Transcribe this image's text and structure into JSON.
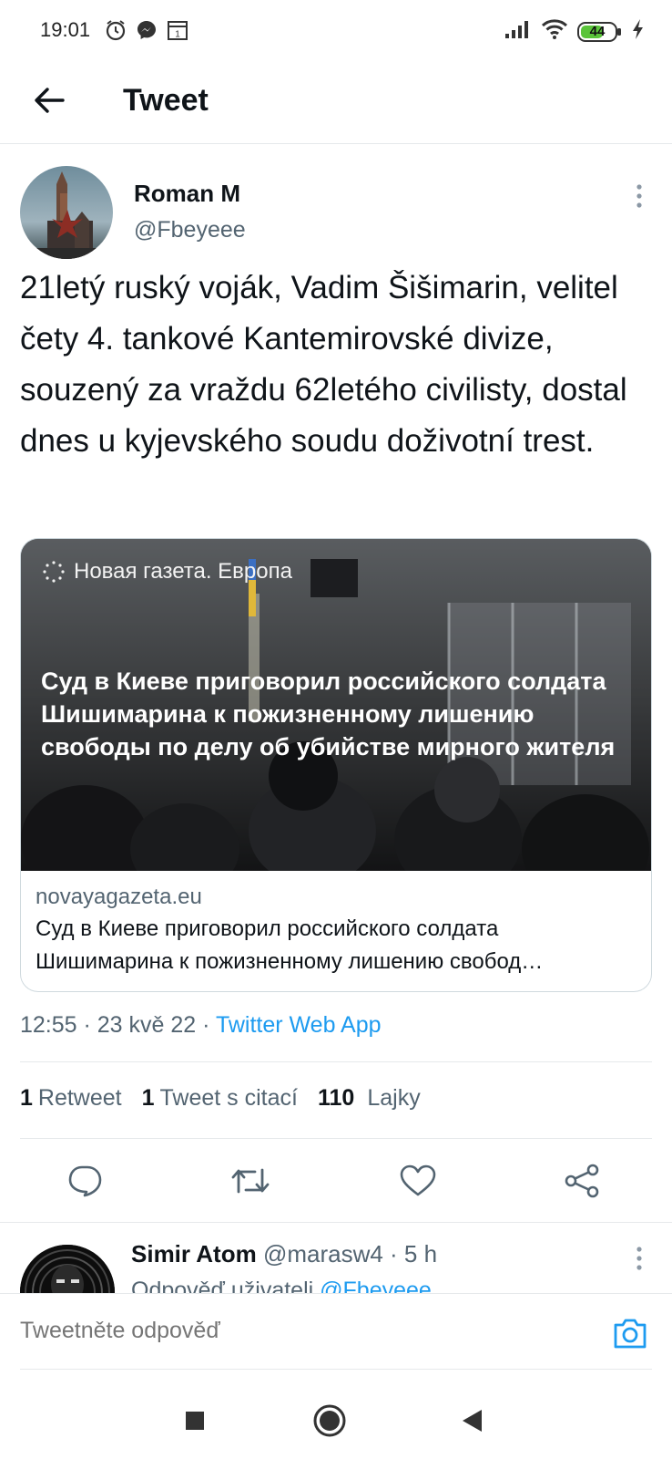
{
  "status_bar": {
    "time": "19:01",
    "notification_icons": [
      "alarm-icon",
      "messenger-icon",
      "calendar-icon"
    ],
    "calendar_badge": "1",
    "battery": "44",
    "signal_icon": "signal-icon",
    "wifi_icon": "wifi-icon",
    "charging_icon": "charging-bolt-icon"
  },
  "header": {
    "back_icon": "arrow-left-icon",
    "title": "Tweet"
  },
  "tweet": {
    "author_name": "Roman M",
    "author_handle": "@Fbeyeee",
    "text": "21letý ruský voják, Vadim Šišimarin, velitel čety 4. tankové Kantemirovské divize, souzený za vraždu 62letého civilisty, dostal dnes u kyjevského soudu doživotní trest.",
    "card": {
      "image_logo_text": "Новая газета. Европа",
      "image_overlay_title": "Суд в Киеве приговорил российского солдата Шишимарина к пожизненному лишению свободы по делу об убийстве мирного жителя",
      "domain": "novayagazeta.eu",
      "description": "Суд в Киеве приговорил российского солдата Шишимарина к пожизненному лишению свобод…"
    },
    "timestamp": "12:55 · 23 kvě 22 · ",
    "source_app": "Twitter Web App",
    "stats": {
      "retweets_count": "1",
      "retweets_label": "Retweet",
      "quotes_count": "1",
      "quotes_label": "Tweet s citací",
      "likes_count": "110",
      "likes_label": "Lajky"
    },
    "actions": [
      "reply-icon",
      "retweet-icon",
      "like-icon",
      "share-icon"
    ]
  },
  "reply": {
    "name": "Simir Atom",
    "handle_time": " @marasw4 · 5 h",
    "reply_to_prefix": "Odpověď uživateli ",
    "reply_to_handle": "@Fbeyeee"
  },
  "compose": {
    "placeholder": "Tweetněte odpověď",
    "camera_icon": "camera-icon"
  },
  "nav_bar": [
    "recents-square-icon",
    "home-circle-icon",
    "back-triangle-icon"
  ],
  "colors": {
    "accent": "#1d9bf0",
    "text_primary": "#0f1419",
    "text_secondary": "#536471",
    "divider": "#e6e9eb"
  }
}
